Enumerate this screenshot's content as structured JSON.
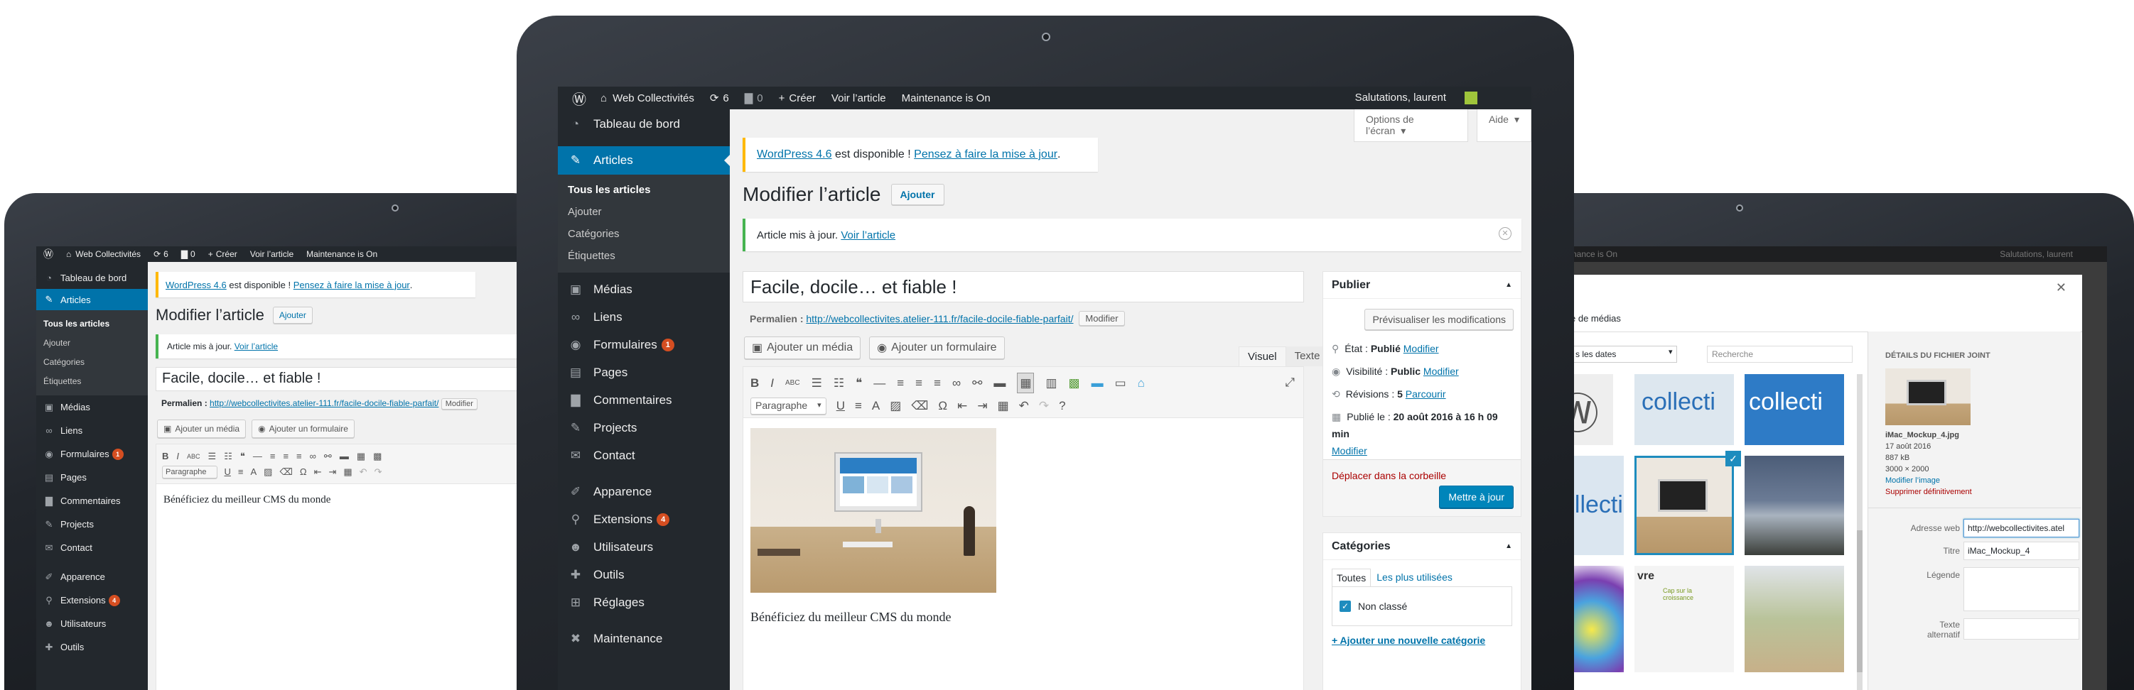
{
  "admin_bar": {
    "site_name": "Web Collectivités",
    "updates": "6",
    "comments": "0",
    "new_label": "Créer",
    "view_post": "Voir l’article",
    "maintenance": "Maintenance is On",
    "greeting": "Salutations, laurent"
  },
  "menu": {
    "dashboard": "Tableau de bord",
    "posts": "Articles",
    "posts_sub": [
      "Tous les articles",
      "Ajouter",
      "Catégories",
      "Étiquettes"
    ],
    "media": "Médias",
    "links": "Liens",
    "forms": "Formulaires",
    "forms_badge": "1",
    "pages": "Pages",
    "comments": "Commentaires",
    "projects": "Projects",
    "contact": "Contact",
    "appearance": "Apparence",
    "plugins": "Extensions",
    "plugins_badge": "4",
    "users": "Utilisateurs",
    "tools": "Outils",
    "settings": "Réglages",
    "maintenance": "Maintenance"
  },
  "screen_options": "Options de l’écran",
  "help": "Aide",
  "update_notice": {
    "link1": "WordPress 4.6",
    "text": "est disponible !",
    "link2": "Pensez à faire la mise à jour",
    "end": "."
  },
  "page_title": "Modifier l’article",
  "add_new": "Ajouter",
  "updated_notice": {
    "text": "Article mis à jour.",
    "link": "Voir l’article"
  },
  "post_title": "Facile, docile… et fiable !",
  "permalink": {
    "label": "Permalien :",
    "url": "http://webcollectivites.atelier-111.fr/facile-docile-fiable-parfait/",
    "edit": "Modifier"
  },
  "editor": {
    "add_media": "Ajouter un média",
    "add_form": "Ajouter un formulaire",
    "tab_visual": "Visuel",
    "tab_text": "Texte",
    "format_select": "Paragraphe",
    "content": "Bénéficiez du meilleur CMS du monde"
  },
  "publish": {
    "title": "Publier",
    "preview": "Prévisualiser les modifications",
    "status_label": "État :",
    "status_value": "Publié",
    "status_edit": "Modifier",
    "visibility_label": "Visibilité :",
    "visibility_value": "Public",
    "visibility_edit": "Modifier",
    "revisions_label": "Révisions :",
    "revisions_value": "5",
    "revisions_link": "Parcourir",
    "published_label": "Publié le :",
    "published_value": "20 août 2016 à 16 h 09 min",
    "published_edit": "Modifier",
    "trash": "Déplacer dans la corbeille",
    "update": "Mettre à jour"
  },
  "categories": {
    "title": "Catégories",
    "tab_all": "Toutes",
    "tab_popular": "Les plus utilisées",
    "item": "Non classé",
    "add": "+ Ajouter une nouvelle catégorie"
  },
  "media_modal": {
    "maintenance": "nance is On",
    "greeting": "Salutations, laurent",
    "tab": "e de médias",
    "dates": "s les dates",
    "search": "Recherche",
    "thumb_text": "collecti",
    "thumb_text2": "vre",
    "thumb_text3": "Cap sur la croissance",
    "details_title": "DÉTAILS DU FICHIER JOINT",
    "file_name": "iMac_Mockup_4.jpg",
    "file_date": "17 août 2016",
    "file_size": "887 kB",
    "file_dims": "3000 × 2000",
    "edit_image": "Modifier l’image",
    "delete": "Supprimer définitivement",
    "url_label": "Adresse web",
    "url_value": "http://webcollectivites.atel",
    "title_label": "Titre",
    "title_value": "iMac_Mockup_4",
    "caption_label": "Légende",
    "alt_label": "Texte alternatif"
  },
  "colors": {
    "admin_dark": "#23282d",
    "admin_blue": "#0073aa",
    "badge": "#d54e21",
    "notice_warn": "#ffb900",
    "notice_ok": "#46b450",
    "trash": "#a00"
  }
}
